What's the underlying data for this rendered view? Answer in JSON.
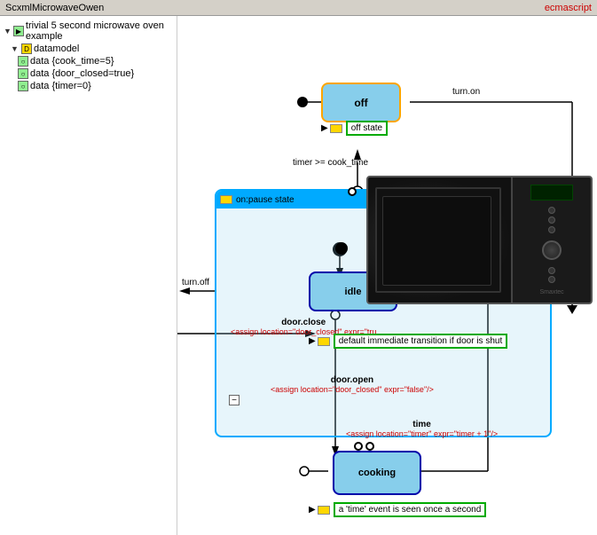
{
  "titleBar": {
    "title": "ScxmlMicrowaveOwen",
    "lang": "ecmascript"
  },
  "tree": {
    "root": "trivial 5 second microwave oven example",
    "datamodel": "datamodel",
    "items": [
      {
        "indent": 2,
        "label": "data {cook_time=5}"
      },
      {
        "indent": 2,
        "label": "data {door_closed=true}"
      },
      {
        "indent": 2,
        "label": "data {timer=0}"
      }
    ]
  },
  "states": {
    "off": {
      "label": "off"
    },
    "on": {
      "label": "on"
    },
    "idle": {
      "label": "idle"
    },
    "cooking": {
      "label": "cooking"
    }
  },
  "stateLabels": {
    "off_state": "off state",
    "on_pause": "on:pause state"
  },
  "transitions": {
    "turn_on": "turn.on",
    "turn_off": "turn.off",
    "timer_cond": "timer >= cook_time",
    "door_close": "door.close",
    "door_closed_lbl": "door_closed",
    "door_open": "door.open",
    "time_lbl": "time",
    "assign1": "<assign location=\"door_closed\" expr=\"tru",
    "assign1_full": "<assign location=\"door_closed\" expr=\"true\"/>",
    "assign_door_open": "<assign location=\"door_closed\" expr=\"false\"/>",
    "assign_timer": "<assign location=\"timer\" expr=\"timer + 1\"/>",
    "default_immediate": "default immediate transition if door is shut",
    "time_event": "a 'time' event is seen once a second"
  },
  "statusBars": {
    "offState": "off state",
    "onPause": "on:pause state",
    "defaultImmediate": "default immediate transition if door is shut",
    "timeEvent": "a 'time' event is seen once a second"
  }
}
